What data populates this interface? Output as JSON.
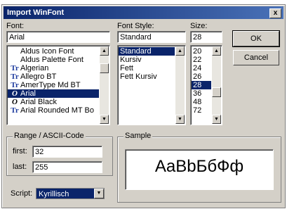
{
  "window": {
    "title": "Import WinFont",
    "close_glyph": "x"
  },
  "font": {
    "label": "Font:",
    "value": "Arial",
    "items": [
      {
        "icon": "",
        "name": "Aldus Icon Font"
      },
      {
        "icon": "",
        "name": "Aldus Palette Font"
      },
      {
        "icon": "Tr",
        "name": "Algerian"
      },
      {
        "icon": "Tr",
        "name": "Allegro BT"
      },
      {
        "icon": "Tr",
        "name": "AmerType Md BT"
      },
      {
        "icon": "O",
        "name": "Arial",
        "selected": true
      },
      {
        "icon": "O",
        "name": "Arial Black"
      },
      {
        "icon": "Tr",
        "name": "Arial Rounded MT Bo"
      }
    ]
  },
  "style": {
    "label": "Font Style:",
    "value": "Standard",
    "items": [
      {
        "name": "Standard",
        "selected": true
      },
      {
        "name": "Kursiv"
      },
      {
        "name": "Fett"
      },
      {
        "name": "Fett Kursiv"
      }
    ]
  },
  "size": {
    "label": "Size:",
    "value": "28",
    "items": [
      {
        "name": "20"
      },
      {
        "name": "22"
      },
      {
        "name": "24"
      },
      {
        "name": "26"
      },
      {
        "name": "28",
        "selected": true
      },
      {
        "name": "36"
      },
      {
        "name": "48"
      },
      {
        "name": "72"
      }
    ]
  },
  "buttons": {
    "ok": "OK",
    "cancel": "Cancel"
  },
  "range": {
    "title": "Range / ASCII-Code",
    "first_label": "first:",
    "first_value": "32",
    "last_label": "last:",
    "last_value": "255"
  },
  "sample": {
    "title": "Sample",
    "text": "AaBbБбФф"
  },
  "script": {
    "label": "Script:",
    "value": "Kyrillisch"
  }
}
